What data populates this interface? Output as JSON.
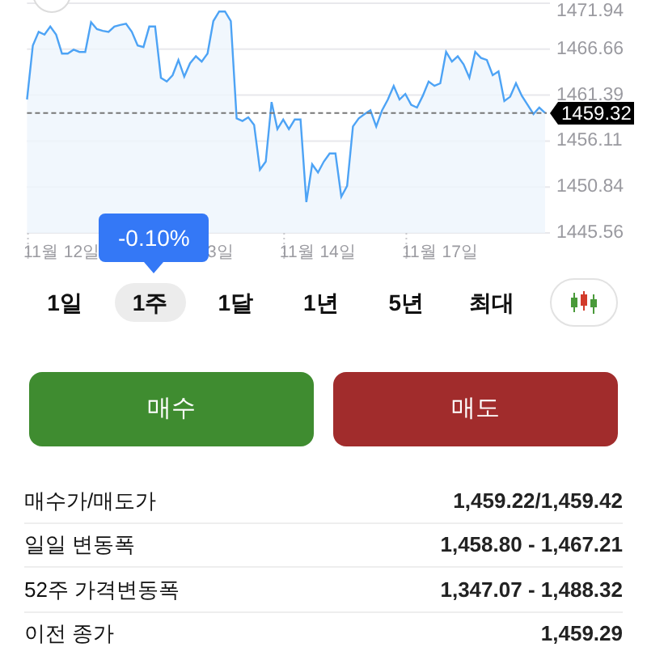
{
  "chart": {
    "tooltip": "-0.10%",
    "covered_label": "3일",
    "chart_data": {
      "type": "area",
      "grid": true,
      "ylim": [
        1445.56,
        1471.94
      ],
      "ref_lines": [
        {
          "axis": "y",
          "value": 1459.32,
          "label": "1459.32"
        }
      ],
      "yticks": [
        {
          "value": 1445.56,
          "label": "1445.56"
        },
        {
          "value": 1450.84,
          "label": "1450.84"
        },
        {
          "value": 1456.11,
          "label": "1456.11"
        },
        {
          "value": 1461.39,
          "label": "1461.39"
        },
        {
          "value": 1466.66,
          "label": "1466.66"
        },
        {
          "value": 1471.94,
          "label": "1471.94"
        }
      ],
      "categories": [
        null,
        null,
        null,
        null,
        null,
        null,
        "11월 12일",
        null,
        null,
        null,
        null,
        null,
        null,
        null,
        null,
        null,
        null,
        null,
        null,
        null,
        null,
        null,
        null,
        null,
        null,
        null,
        null,
        null,
        null,
        null,
        null,
        null,
        null,
        null,
        null,
        null,
        null,
        null,
        null,
        null,
        null,
        null,
        null,
        null,
        null,
        null,
        null,
        null,
        null,
        null,
        "11월 14일",
        null,
        null,
        null,
        null,
        null,
        null,
        null,
        null,
        null,
        null,
        null,
        null,
        null,
        null,
        null,
        null,
        null,
        null,
        null,
        null,
        "11월 17일",
        null,
        null,
        null,
        null,
        null,
        null,
        null,
        null,
        null,
        null,
        null,
        null,
        null,
        null,
        null,
        null,
        null,
        null
      ],
      "series": [
        {
          "color": "#4da3f5",
          "values": [
            1460.89,
            1467.09,
            1468.65,
            1468.34,
            1469.27,
            1468.34,
            1466.16,
            1466.16,
            1466.6,
            1466.35,
            1466.35,
            1469.76,
            1468.96,
            1468.77,
            1468.65,
            1469.27,
            1469.45,
            1469.58,
            1468.65,
            1467.09,
            1466.91,
            1469.27,
            1469.27,
            1463.37,
            1462.94,
            1463.68,
            1465.42,
            1463.5,
            1465.05,
            1465.85,
            1465.23,
            1466.16,
            1469.89,
            1471.0,
            1471.0,
            1469.89,
            1458.72,
            1458.41,
            1458.84,
            1457.97,
            1452.82,
            1453.75,
            1460.58,
            1457.48,
            1458.59,
            1457.48,
            1458.59,
            1458.59,
            1449.1,
            1453.44,
            1452.51,
            1453.75,
            1454.68,
            1454.68,
            1449.72,
            1450.96,
            1457.79,
            1458.72,
            1459.21,
            1459.65,
            1457.79,
            1459.65,
            1460.89,
            1462.44,
            1460.89,
            1461.51,
            1460.27,
            1459.96,
            1461.32,
            1462.94,
            1462.44,
            1462.75,
            1466.35,
            1465.23,
            1465.85,
            1464.92,
            1463.37,
            1466.35,
            1465.67,
            1465.42,
            1463.68,
            1464.12,
            1460.7,
            1461.2,
            1462.75,
            1461.32,
            1460.27,
            1459.21,
            1459.96,
            1459.34
          ]
        }
      ]
    }
  },
  "periods": [
    {
      "label": "1일",
      "selected": false
    },
    {
      "label": "1주",
      "selected": true
    },
    {
      "label": "1달",
      "selected": false
    },
    {
      "label": "1년",
      "selected": false
    },
    {
      "label": "5년",
      "selected": false
    },
    {
      "label": "최대",
      "selected": false
    }
  ],
  "actions": [
    {
      "label": "매수",
      "kind": "buy"
    },
    {
      "label": "매도",
      "kind": "sell"
    }
  ],
  "stats": [
    {
      "label": "매수가/매도가",
      "value": "1,459.22/1,459.42"
    },
    {
      "label": "일일 변동폭",
      "value": "1,458.80 - 1,467.21"
    },
    {
      "label": "52주 가격변동폭",
      "value": "1,347.07 - 1,488.32"
    },
    {
      "label": "이전 종가",
      "value": "1,459.29"
    }
  ]
}
